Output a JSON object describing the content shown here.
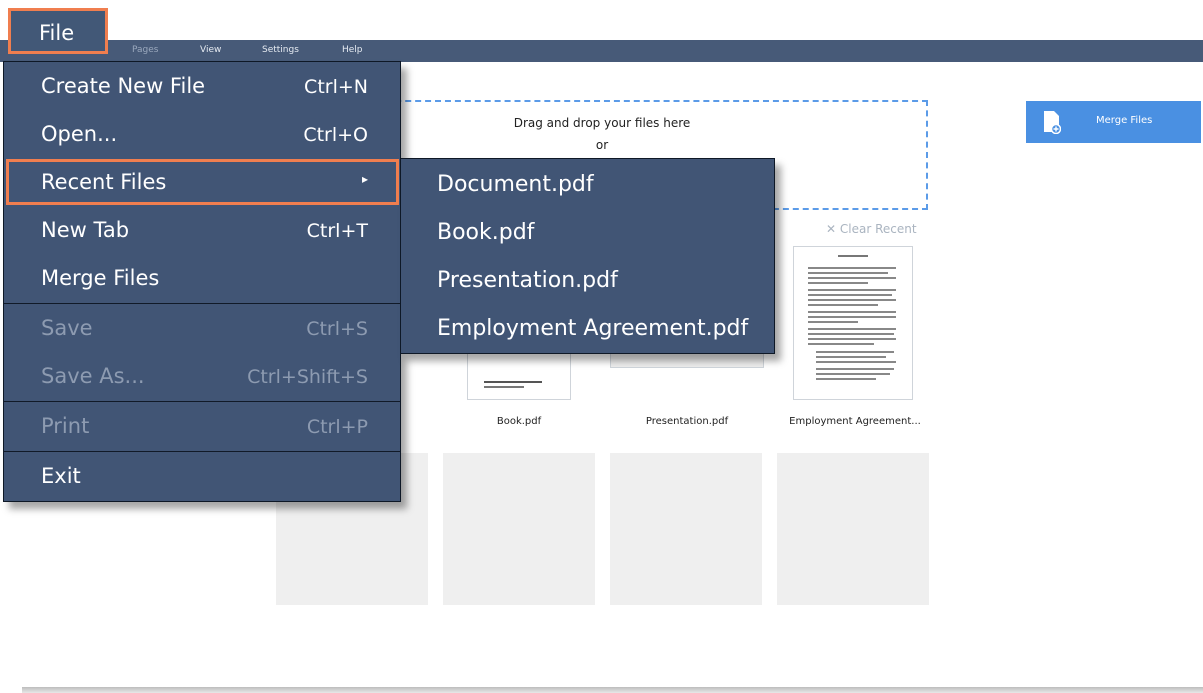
{
  "file_tab": {
    "label": "File"
  },
  "menubar": {
    "items": [
      "Pages",
      "View",
      "Settings",
      "Help"
    ]
  },
  "dropzone": {
    "line1": "Drag and drop your files here",
    "line2": "or"
  },
  "merge_button": {
    "label": "Merge Files",
    "icon": "file-plus-icon"
  },
  "clear_recent": {
    "label": "✕ Clear Recent"
  },
  "recent_thumbnails": [
    {
      "caption": "Book.pdf"
    },
    {
      "caption": "Presentation.pdf"
    },
    {
      "caption": "Employment Agreement..."
    }
  ],
  "file_menu": {
    "items": [
      {
        "label": "Create New File",
        "shortcut": "Ctrl+N",
        "enabled": true
      },
      {
        "label": "Open...",
        "shortcut": "Ctrl+O",
        "enabled": true
      },
      {
        "label": "Recent Files",
        "shortcut": "",
        "enabled": true,
        "has_submenu": true
      },
      {
        "label": "New Tab",
        "shortcut": "Ctrl+T",
        "enabled": true
      },
      {
        "label": "Merge Files",
        "shortcut": "",
        "enabled": true
      },
      {
        "label": "Save",
        "shortcut": "Ctrl+S",
        "enabled": false
      },
      {
        "label": "Save As...",
        "shortcut": "Ctrl+Shift+S",
        "enabled": false
      },
      {
        "label": "Print",
        "shortcut": "Ctrl+P",
        "enabled": false
      },
      {
        "label": "Exit",
        "shortcut": "",
        "enabled": true
      }
    ],
    "submenu_arrow": "▸"
  },
  "recent_submenu": {
    "items": [
      "Document.pdf",
      "Book.pdf",
      "Presentation.pdf",
      "Employment Agreement.pdf"
    ]
  },
  "colors": {
    "menu_bg": "#415575",
    "highlight": "#f07e4f",
    "accent": "#4a90e2"
  }
}
